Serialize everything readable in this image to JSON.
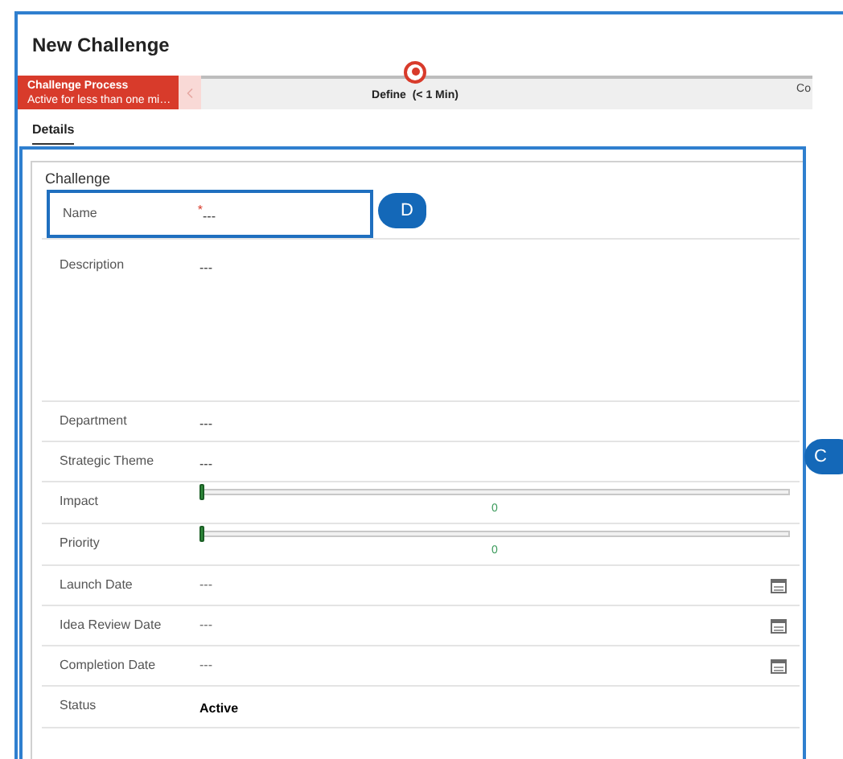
{
  "window": {
    "title": "New Challenge"
  },
  "process": {
    "name": "Challenge Process",
    "status": "Active for less than one mi…",
    "stages": [
      {
        "label": "Define",
        "duration": "(< 1 Min)",
        "selected": true
      },
      {
        "label": "Co",
        "selected": false
      }
    ]
  },
  "tabs": [
    {
      "label": "Details",
      "selected": true
    }
  ],
  "section": {
    "title": "Challenge",
    "fields": [
      {
        "kind": "text",
        "label": "Name",
        "value": "---",
        "required_mark": "*",
        "highlighted": true
      },
      {
        "kind": "textarea",
        "label": "Description",
        "value": "---",
        "highlighted": false
      },
      {
        "kind": "text",
        "label": "Department",
        "value": "---",
        "highlighted": false
      },
      {
        "kind": "text",
        "label": "Strategic Theme",
        "value": "---",
        "highlighted": false
      },
      {
        "kind": "slider",
        "label": "Impact",
        "level": 0,
        "reading": "0",
        "highlighted": false
      },
      {
        "kind": "slider",
        "label": "Priority",
        "level": 0,
        "reading": "0",
        "highlighted": false
      },
      {
        "kind": "date",
        "label": "Launch Date",
        "value": "---",
        "highlighted": false
      },
      {
        "kind": "date",
        "label": "Idea Review Date",
        "value": "---",
        "highlighted": false
      },
      {
        "kind": "date",
        "label": "Completion Date",
        "value": "---",
        "highlighted": false
      },
      {
        "kind": "status",
        "label": "Status",
        "value": "Active",
        "highlighted": false
      }
    ]
  },
  "callouts": [
    {
      "label": "D"
    },
    {
      "label": "C"
    }
  ]
}
